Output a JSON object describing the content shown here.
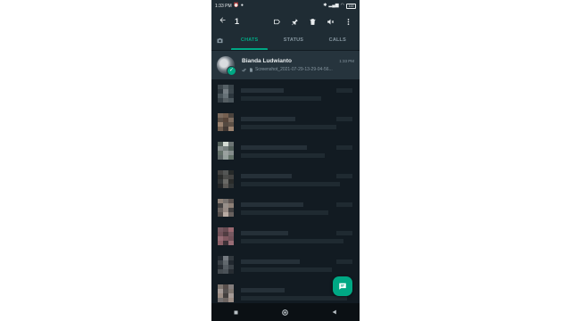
{
  "status_bar": {
    "time": "1:33 PM",
    "battery": "100"
  },
  "action_bar": {
    "selected_count": "1",
    "back_icon": "arrow-left-icon",
    "actions": [
      {
        "name": "label-button",
        "icon": "label-icon"
      },
      {
        "name": "pin-button",
        "icon": "pin-icon"
      },
      {
        "name": "delete-button",
        "icon": "trash-icon"
      },
      {
        "name": "mute-button",
        "icon": "mute-icon"
      },
      {
        "name": "more-button",
        "icon": "more-vert-icon"
      }
    ]
  },
  "tabs": {
    "camera_icon": "camera-icon",
    "items": [
      {
        "label": "CHATS",
        "active": true
      },
      {
        "label": "STATUS",
        "active": false
      },
      {
        "label": "CALLS",
        "active": false
      }
    ]
  },
  "selected_chat": {
    "name": "Bianda Ludwianto",
    "time": "1:33 PM",
    "message": "Screenshot_2021-07-29-13-29-04-56..."
  },
  "colors": {
    "accent": "#00a884",
    "header_bg": "#1f2c34",
    "list_bg": "#121b22",
    "selected_bg": "#26343d"
  }
}
